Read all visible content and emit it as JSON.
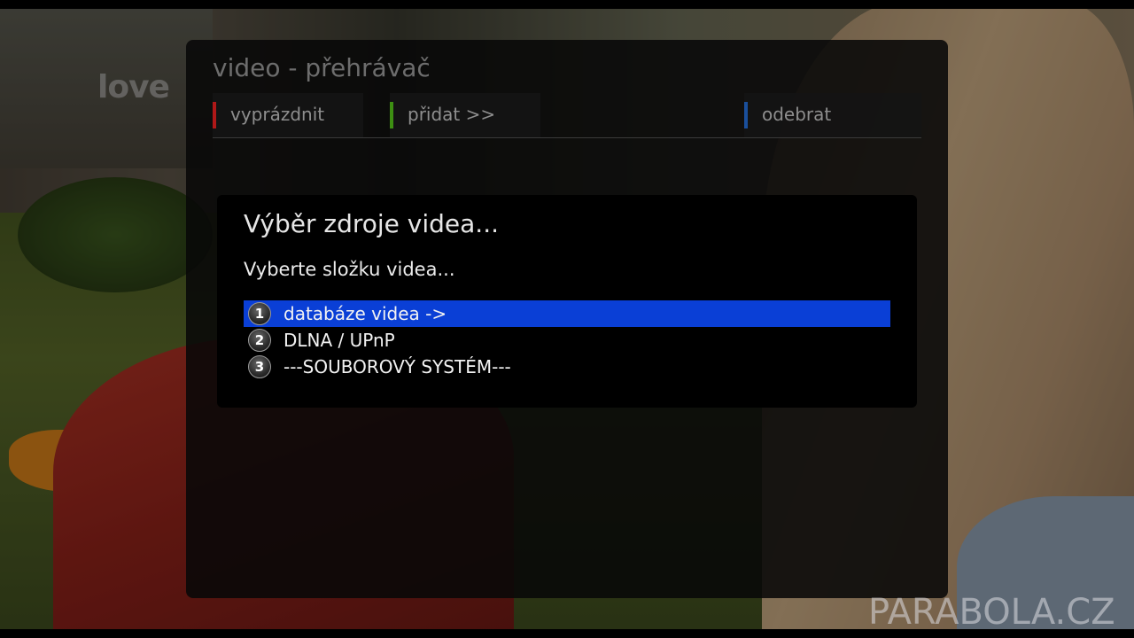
{
  "background": {
    "sign_text": "love"
  },
  "player": {
    "title": "video - přehrávač",
    "toolbar": [
      {
        "label": "vyprázdnit",
        "color": "#b01818"
      },
      {
        "label": "přidat >>",
        "color": "#3d8f12"
      },
      {
        "label": "odebrat",
        "color": "#1a4f9c"
      }
    ]
  },
  "dialog": {
    "title": "Výběr zdroje videa...",
    "subtitle": "Vyberte složku videa...",
    "selected_color": "#0a3fd6",
    "items": [
      {
        "number": "1",
        "label": "databáze videa ->",
        "selected": true
      },
      {
        "number": "2",
        "label": "DLNA / UPnP",
        "selected": false
      },
      {
        "number": "3",
        "label": "---SOUBOROVÝ SYSTÉM---",
        "selected": false
      }
    ]
  },
  "watermark": "PARABOLA.CZ"
}
